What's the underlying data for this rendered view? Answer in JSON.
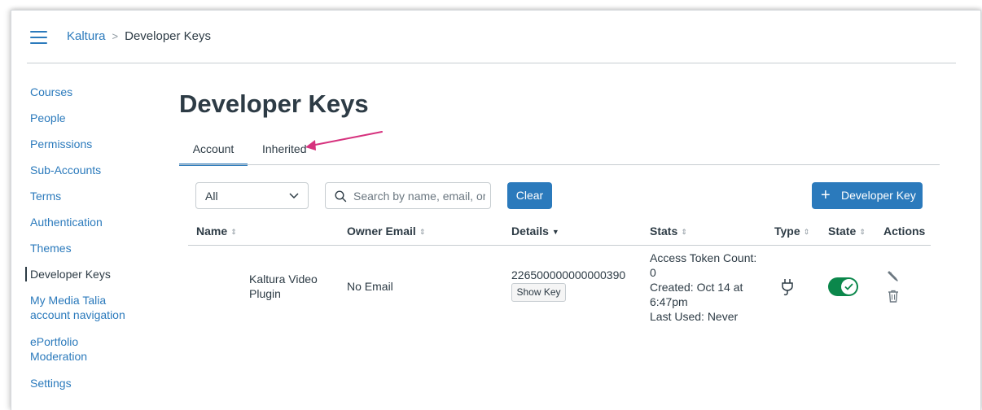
{
  "header": {
    "breadcrumb": {
      "root": "Kaltura",
      "separator": ">",
      "current": "Developer Keys"
    }
  },
  "sidebar": {
    "items": [
      {
        "label": "Courses"
      },
      {
        "label": "People"
      },
      {
        "label": "Permissions"
      },
      {
        "label": "Sub-Accounts"
      },
      {
        "label": "Terms"
      },
      {
        "label": "Authentication"
      },
      {
        "label": "Themes"
      },
      {
        "label": "Developer Keys",
        "active": true
      },
      {
        "label": "My Media Talia",
        "label2": "account navigation"
      },
      {
        "label": "ePortfolio",
        "label2": "Moderation"
      },
      {
        "label": "Settings"
      }
    ]
  },
  "main": {
    "title": "Developer Keys",
    "tabs": [
      {
        "label": "Account",
        "selected": true
      },
      {
        "label": "Inherited",
        "selected": false
      }
    ],
    "filter": {
      "selected": "All"
    },
    "search": {
      "placeholder": "Search by name, email, or"
    },
    "clear_label": "Clear",
    "add_button": {
      "icon": "+",
      "label": "Developer Key"
    },
    "table": {
      "columns": {
        "name": "Name",
        "owner_email": "Owner Email",
        "details": "Details",
        "stats": "Stats",
        "type": "Type",
        "state": "State",
        "actions": "Actions"
      },
      "rows": [
        {
          "name_line1": "Kaltura Video",
          "name_line2": "Plugin",
          "owner_email": "No Email",
          "key_id": "226500000000000390",
          "show_key_label": "Show Key",
          "stats": {
            "line1": "Access Token Count:",
            "line2": "0",
            "line3": "Created: Oct 14 at",
            "line4": "6:47pm",
            "line5": "Last Used: Never"
          },
          "type_icon": "plug-icon",
          "state": "on"
        }
      ]
    }
  },
  "colors": {
    "link": "#2b7abc",
    "text": "#2d3b45",
    "primary_button": "#2b7abc",
    "toggle_on": "#0b874b",
    "annotation_arrow": "#d6327e"
  }
}
